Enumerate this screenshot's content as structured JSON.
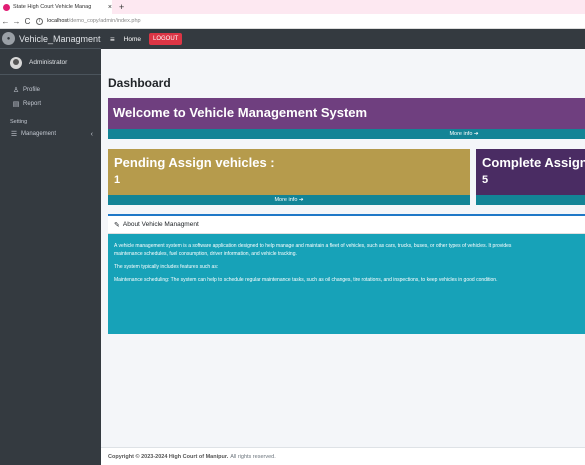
{
  "browser": {
    "tab_title": "State High Court Vehicle Manag",
    "tab_close": "×",
    "new_tab": "+",
    "back": "←",
    "forward": "→",
    "reload": "C",
    "info": "i",
    "url_host": "localhost",
    "url_path": "/demo_copy/admin/index.php"
  },
  "sidebar": {
    "brand": "Vehicle_Managment",
    "user": "Administrator",
    "items": [
      {
        "icon": "♙",
        "label": "Profile"
      },
      {
        "icon": "▤",
        "label": "Report"
      }
    ],
    "section_header": "Setting",
    "management": {
      "icon": "☰",
      "label": "Management",
      "chevron": "‹"
    }
  },
  "topnav": {
    "hamburger": "≡",
    "home": "Home",
    "logout": "LOGOUT"
  },
  "main": {
    "page_title": "Dashboard",
    "welcome_title": "Welcome to Vehicle Management System",
    "more_info": "More info ➔",
    "pending": {
      "title": "Pending Assign vehicles :",
      "count": "1"
    },
    "complete": {
      "title": "Complete Assign",
      "count": "5"
    },
    "about": {
      "header": "About Vehicle Managment",
      "p1": "A vehicle management system is a software application designed to help manage and maintain a fleet of vehicles, such as cars, trucks, buses, or other types of vehicles. It provides",
      "p1b": "maintenance schedules, fuel consumption, driver information, and vehicle tracking.",
      "p2": "The system typically includes features such as:",
      "p3": "Maintenance scheduling: The system can help to schedule regular maintenance tasks, such as oil changes, tire rotations, and inspections, to keep vehicles in good condition."
    }
  },
  "footer": {
    "copyright": "Copyright © 2023-2024 High Court of Manipur.",
    "rights": "All rights reserved."
  },
  "colors": {
    "sidebar_bg": "#343a40",
    "welcome_bg": "#6f3f7f",
    "pending_bg": "#b69b4c",
    "complete_bg": "#4a2c63",
    "info_footer": "#138496",
    "about_bg": "#17a2b8",
    "logout_bg": "#dc3545"
  }
}
